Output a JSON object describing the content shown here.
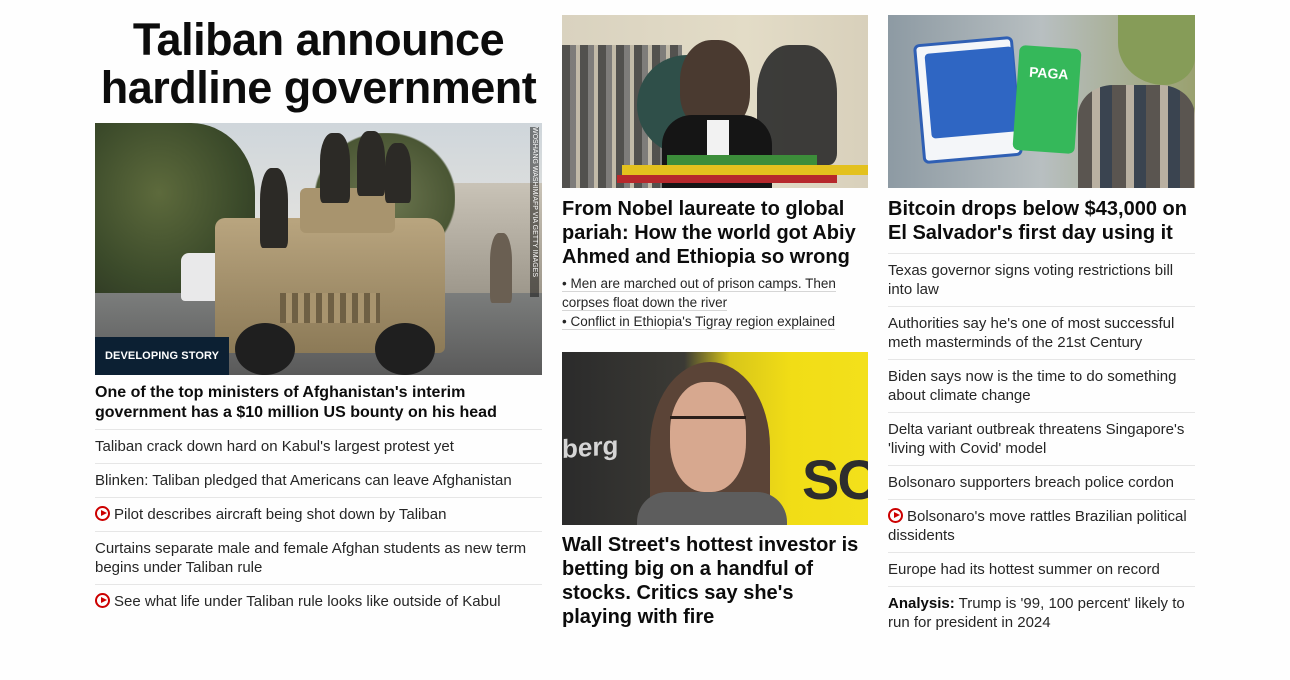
{
  "col1": {
    "headline": "Taliban announce hardline government",
    "image_credit": "WOSHANG WASHIM/AFP VIA GETTY IMAGES",
    "badge": "DEVELOPING STORY",
    "subhead": "One of the top ministers of Afghanistan's interim government has a $10 million US bounty on his head",
    "links": [
      {
        "text": "Taliban crack down hard on Kabul's largest protest yet",
        "video": false
      },
      {
        "text": "Blinken: Taliban pledged that Americans can leave Afghanistan",
        "video": false
      },
      {
        "text": "Pilot describes aircraft being shot down by Taliban",
        "video": true
      },
      {
        "text": "Curtains separate male and female Afghan students as new term begins under Taliban rule",
        "video": false
      },
      {
        "text": "See what life under Taliban rule looks like outside of Kabul",
        "video": true
      }
    ]
  },
  "col2": {
    "story1": {
      "title": "From Nobel laureate to global pariah: How the world got Abiy Ahmed and Ethiopia so wrong",
      "bullets": [
        "• Men are marched out of prison camps. Then corpses float down the river",
        "• Conflict in Ethiopia's Tigray region explained"
      ]
    },
    "story2": {
      "image_text_left": "berg",
      "image_text_right": "SO",
      "title": "Wall Street's hottest investor is betting big on a handful of stocks. Critics say she's playing with fire"
    }
  },
  "col3": {
    "image_sign_text": "PAGA",
    "title": "Bitcoin drops below $43,000 on El Salvador's first day using it",
    "links": [
      {
        "text": "Texas governor signs voting restrictions bill into law",
        "video": false,
        "prefix": ""
      },
      {
        "text": "Authorities say he's one of most successful meth masterminds of the 21st Century",
        "video": false,
        "prefix": ""
      },
      {
        "text": "Biden says now is the time to do something about climate change",
        "video": false,
        "prefix": ""
      },
      {
        "text": "Delta variant outbreak threatens Singapore's 'living with Covid' model",
        "video": false,
        "prefix": ""
      },
      {
        "text": "Bolsonaro supporters breach police cordon",
        "video": false,
        "prefix": ""
      },
      {
        "text": "Bolsonaro's move rattles Brazilian political dissidents",
        "video": true,
        "prefix": ""
      },
      {
        "text": "Europe had its hottest summer on record",
        "video": false,
        "prefix": ""
      },
      {
        "text": "Trump is '99, 100 percent' likely to run for president in 2024",
        "video": false,
        "prefix": "Analysis:"
      }
    ]
  },
  "colors": {
    "badge_bg": "#0c2033",
    "play_icon": "#cc0000",
    "divider": "#e6e6e6"
  }
}
